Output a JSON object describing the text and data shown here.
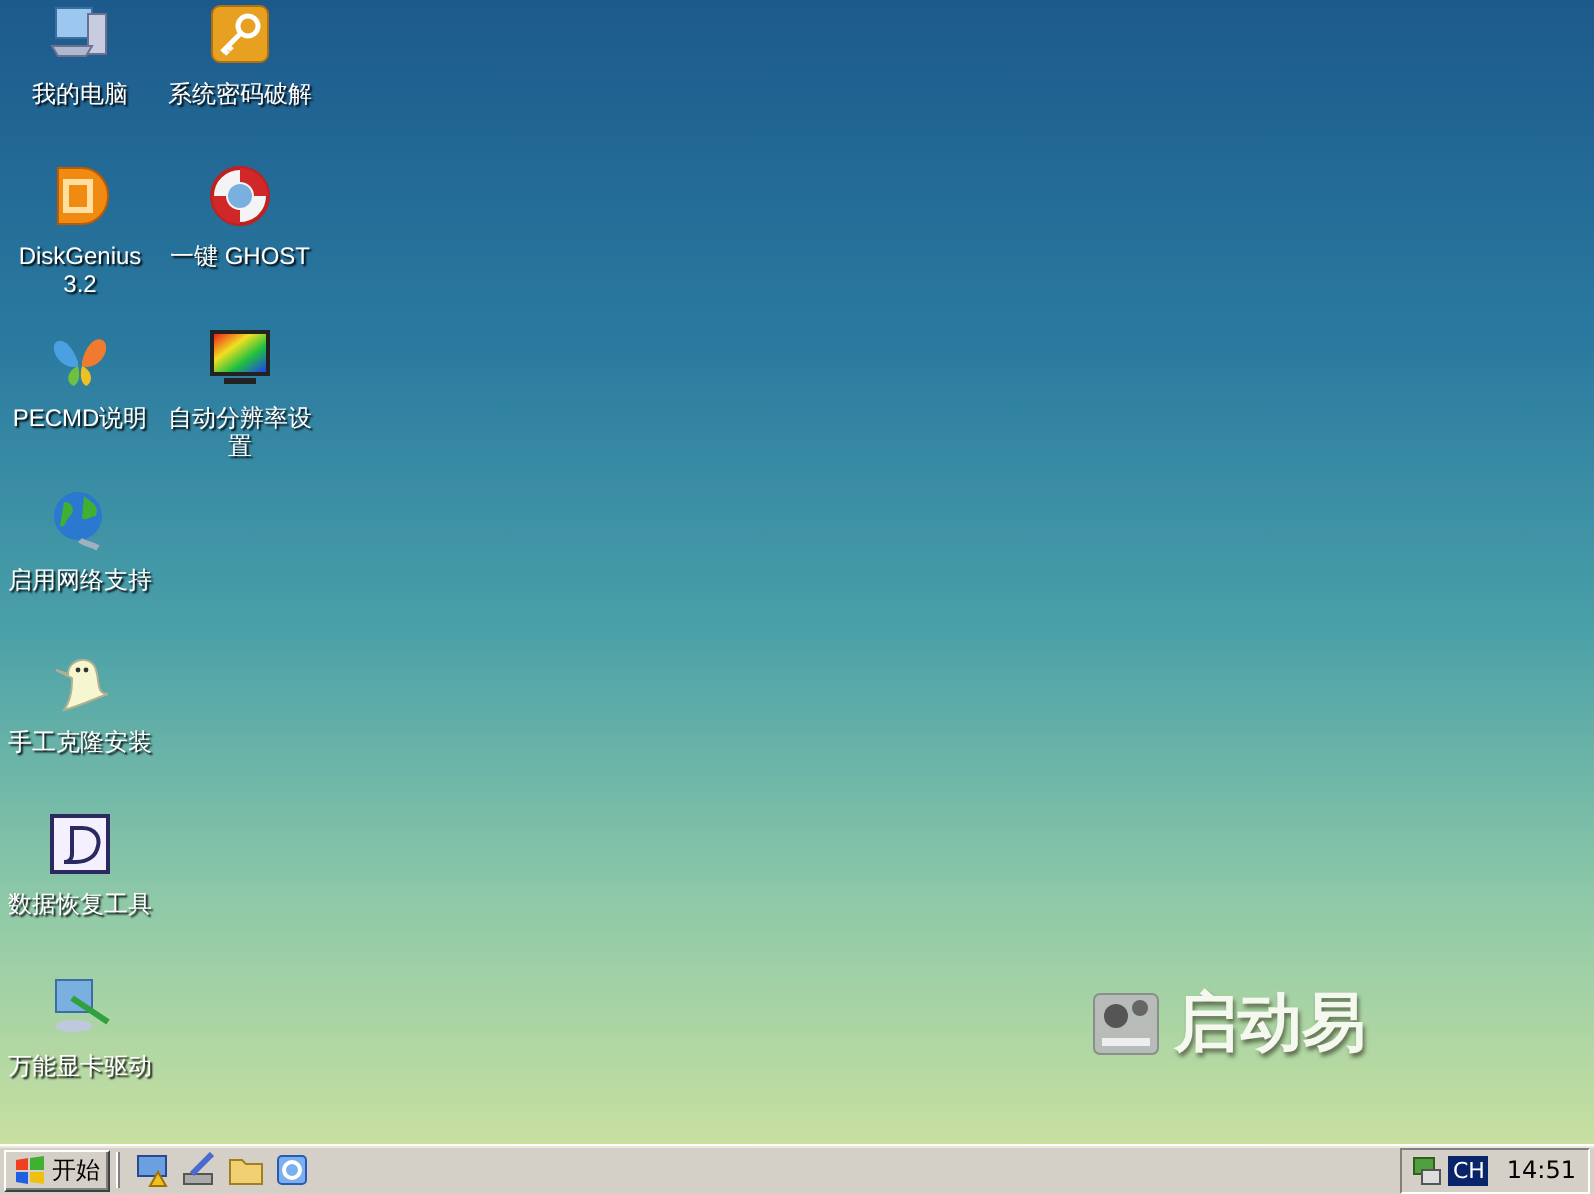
{
  "desktop": {
    "rows": [
      [
        {
          "label": "我的电脑",
          "kind": "computer"
        },
        {
          "label": "系统密码破解",
          "kind": "key"
        }
      ],
      [
        {
          "label": "DiskGenius 3.2",
          "kind": "disk"
        },
        {
          "label": "一键 GHOST",
          "kind": "lifebuoy"
        }
      ],
      [
        {
          "label": "PECMD说明",
          "kind": "butterfly"
        },
        {
          "label": "自动分辨率设置",
          "kind": "monitor"
        }
      ],
      [
        {
          "label": "启用网络支持",
          "kind": "globe"
        }
      ],
      [
        {
          "label": "手工克隆安装",
          "kind": "ghost"
        }
      ],
      [
        {
          "label": "数据恢复工具",
          "kind": "letter"
        }
      ],
      [
        {
          "label": "万能显卡驱动",
          "kind": "driver"
        }
      ]
    ],
    "wallpaper_logo": {
      "text": "启动易"
    }
  },
  "taskbar": {
    "start_button": "开始",
    "quick_launch": [
      {
        "kind": "computer-tool"
      },
      {
        "kind": "brush"
      },
      {
        "kind": "folder"
      },
      {
        "kind": "browser"
      }
    ],
    "tray": {
      "language": "CH",
      "clock": "14:51"
    }
  }
}
